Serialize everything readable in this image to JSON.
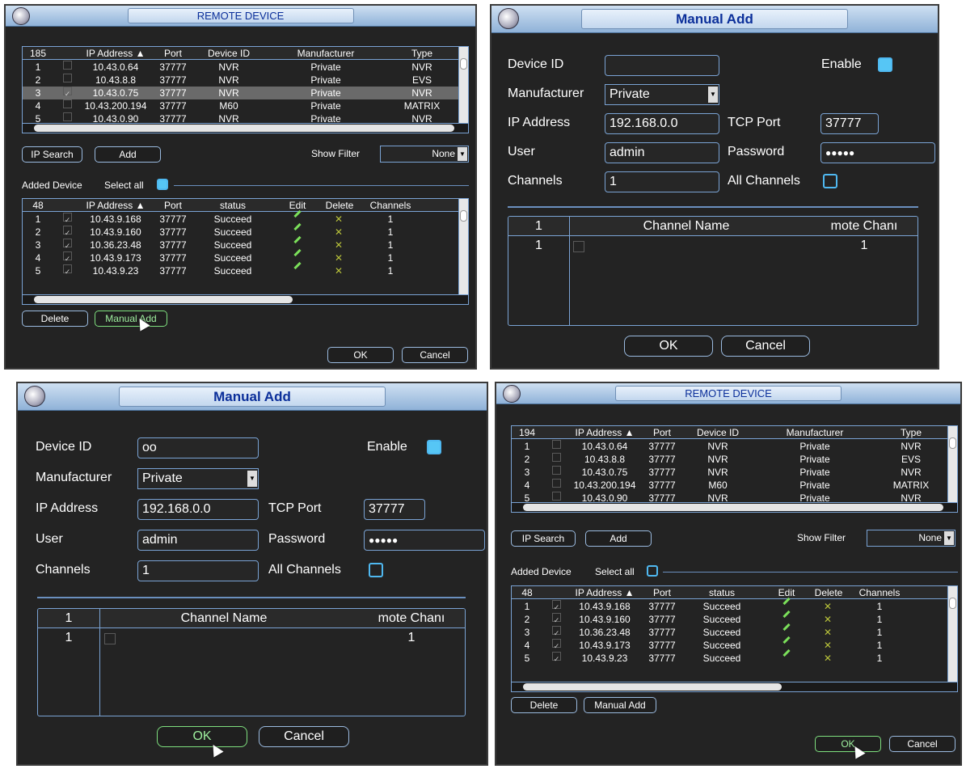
{
  "p1": {
    "title": "REMOTE DEVICE",
    "top_table": {
      "count": "185",
      "headers": {
        "ip": "IP Address ▲",
        "port": "Port",
        "devid": "Device ID",
        "mfr": "Manufacturer",
        "type": "Type"
      },
      "rows": [
        {
          "n": "1",
          "ip": "10.43.0.64",
          "port": "37777",
          "devid": "NVR",
          "mfr": "Private",
          "type": "NVR",
          "checked": ""
        },
        {
          "n": "2",
          "ip": "10.43.8.8",
          "port": "37777",
          "devid": "NVR",
          "mfr": "Private",
          "type": "EVS",
          "checked": ""
        },
        {
          "n": "3",
          "ip": "10.43.0.75",
          "port": "37777",
          "devid": "NVR",
          "mfr": "Private",
          "type": "NVR",
          "checked": "✓"
        },
        {
          "n": "4",
          "ip": "10.43.200.194",
          "port": "37777",
          "devid": "M60",
          "mfr": "Private",
          "type": "MATRIX",
          "checked": ""
        },
        {
          "n": "5",
          "ip": "10.43.0.90",
          "port": "37777",
          "devid": "NVR",
          "mfr": "Private",
          "type": "NVR",
          "checked": ""
        }
      ]
    },
    "ip_search": "IP Search",
    "add": "Add",
    "show_filter": "Show Filter",
    "filter_value": "None",
    "added_device": "Added Device",
    "select_all": "Select all",
    "bottom_table": {
      "count": "48",
      "headers": {
        "ip": "IP Address ▲",
        "port": "Port",
        "status": "status",
        "edit": "Edit",
        "del": "Delete",
        "ch": "Channels"
      },
      "rows": [
        {
          "n": "1",
          "ip": "10.43.9.168",
          "port": "37777",
          "status": "Succeed",
          "ch": "1"
        },
        {
          "n": "2",
          "ip": "10.43.9.160",
          "port": "37777",
          "status": "Succeed",
          "ch": "1"
        },
        {
          "n": "3",
          "ip": "10.36.23.48",
          "port": "37777",
          "status": "Succeed",
          "ch": "1"
        },
        {
          "n": "4",
          "ip": "10.43.9.173",
          "port": "37777",
          "status": "Succeed",
          "ch": "1"
        },
        {
          "n": "5",
          "ip": "10.43.9.23",
          "port": "37777",
          "status": "Succeed",
          "ch": "1"
        }
      ]
    },
    "delete": "Delete",
    "manual_add": "Manual Add",
    "ok": "OK",
    "cancel": "Cancel"
  },
  "p2": {
    "title": "Manual Add",
    "device_id_label": "Device ID",
    "device_id": "",
    "enable_label": "Enable",
    "manufacturer_label": "Manufacturer",
    "manufacturer": "Private",
    "ip_label": "IP Address",
    "ip": "192.168.0.0",
    "tcp_label": "TCP Port",
    "tcp": "37777",
    "user_label": "User",
    "user": "admin",
    "password_label": "Password",
    "password": "●●●●●",
    "channels_label": "Channels",
    "channels": "1",
    "all_channels_label": "All Channels",
    "ch_table": {
      "h1": "1",
      "h2": "Channel Name",
      "h3": "mote Chanı",
      "r1": "1",
      "r3": "1"
    },
    "ok": "OK",
    "cancel": "Cancel"
  },
  "p3": {
    "title": "Manual Add",
    "device_id_label": "Device ID",
    "device_id": "oo",
    "enable_label": "Enable",
    "manufacturer_label": "Manufacturer",
    "manufacturer": "Private",
    "ip_label": "IP Address",
    "ip": "192.168.0.0",
    "tcp_label": "TCP Port",
    "tcp": "37777",
    "user_label": "User",
    "user": "admin",
    "password_label": "Password",
    "password": "●●●●●",
    "channels_label": "Channels",
    "channels": "1",
    "all_channels_label": "All Channels",
    "ch_table": {
      "h1": "1",
      "h2": "Channel Name",
      "h3": "mote Chanı",
      "r1": "1",
      "r3": "1"
    },
    "ok": "OK",
    "cancel": "Cancel"
  },
  "p4": {
    "title": "REMOTE DEVICE",
    "top_table": {
      "count": "194",
      "headers": {
        "ip": "IP Address ▲",
        "port": "Port",
        "devid": "Device ID",
        "mfr": "Manufacturer",
        "type": "Type"
      },
      "rows": [
        {
          "n": "1",
          "ip": "10.43.0.64",
          "port": "37777",
          "devid": "NVR",
          "mfr": "Private",
          "type": "NVR",
          "checked": ""
        },
        {
          "n": "2",
          "ip": "10.43.8.8",
          "port": "37777",
          "devid": "NVR",
          "mfr": "Private",
          "type": "EVS",
          "checked": ""
        },
        {
          "n": "3",
          "ip": "10.43.0.75",
          "port": "37777",
          "devid": "NVR",
          "mfr": "Private",
          "type": "NVR",
          "checked": ""
        },
        {
          "n": "4",
          "ip": "10.43.200.194",
          "port": "37777",
          "devid": "M60",
          "mfr": "Private",
          "type": "MATRIX",
          "checked": ""
        },
        {
          "n": "5",
          "ip": "10.43.0.90",
          "port": "37777",
          "devid": "NVR",
          "mfr": "Private",
          "type": "NVR",
          "checked": ""
        }
      ]
    },
    "ip_search": "IP Search",
    "add": "Add",
    "show_filter": "Show Filter",
    "filter_value": "None",
    "added_device": "Added Device",
    "select_all": "Select all",
    "bottom_table": {
      "count": "48",
      "headers": {
        "ip": "IP Address ▲",
        "port": "Port",
        "status": "status",
        "edit": "Edit",
        "del": "Delete",
        "ch": "Channels"
      },
      "rows": [
        {
          "n": "1",
          "ip": "10.43.9.168",
          "port": "37777",
          "status": "Succeed",
          "ch": "1"
        },
        {
          "n": "2",
          "ip": "10.43.9.160",
          "port": "37777",
          "status": "Succeed",
          "ch": "1"
        },
        {
          "n": "3",
          "ip": "10.36.23.48",
          "port": "37777",
          "status": "Succeed",
          "ch": "1"
        },
        {
          "n": "4",
          "ip": "10.43.9.173",
          "port": "37777",
          "status": "Succeed",
          "ch": "1"
        },
        {
          "n": "5",
          "ip": "10.43.9.23",
          "port": "37777",
          "status": "Succeed",
          "ch": "1"
        }
      ]
    },
    "delete": "Delete",
    "manual_add": "Manual Add",
    "ok": "OK",
    "cancel": "Cancel"
  }
}
